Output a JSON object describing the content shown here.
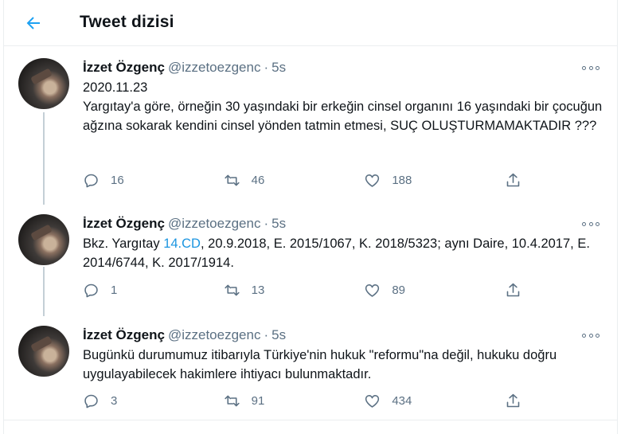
{
  "header": {
    "title": "Tweet dizisi"
  },
  "tweets": [
    {
      "author": "İzzet Özgenç",
      "handle": "@izzetoezgenc",
      "separator": "·",
      "time": "5s",
      "date_line": "2020.11.23",
      "text": "Yargıtay'a göre, örneğin 30 yaşındaki bir erkeğin cinsel organını 16 yaşındaki bir çocuğun ağzına sokarak kendini cinsel yönden tatmin etmesi, SUÇ OLUŞTURMAMAKTADIR ???",
      "replies": "16",
      "retweets": "46",
      "likes": "188"
    },
    {
      "author": "İzzet Özgenç",
      "handle": "@izzetoezgenc",
      "separator": "·",
      "time": "5s",
      "text_prefix": "Bkz. Yargıtay ",
      "link": "14.CD",
      "text_suffix": ", 20.9.2018, E. 2015/1067, K. 2018/5323; aynı Daire, 10.4.2017, E. 2014/6744, K. 2017/1914.",
      "replies": "1",
      "retweets": "13",
      "likes": "89"
    },
    {
      "author": "İzzet Özgenç",
      "handle": "@izzetoezgenc",
      "separator": "·",
      "time": "5s",
      "text": "Bugünkü durumumuz itibarıyla Türkiye'nin hukuk \"reformu\"na değil, hukuku doğru uygulayabilecek hakimlere ihtiyacı bulunmaktadır.",
      "replies": "3",
      "retweets": "91",
      "likes": "434"
    }
  ],
  "icons": {
    "back": "arrow-left-icon",
    "more": "more-horizontal-icon",
    "reply": "reply-icon",
    "retweet": "retweet-icon",
    "like": "heart-icon",
    "share": "share-icon"
  },
  "colors": {
    "accent": "#1da1f2",
    "link": "#1b95e0",
    "muted": "#5b7083",
    "thread_line": "#c4cfd6",
    "divider": "#ebeef0"
  }
}
